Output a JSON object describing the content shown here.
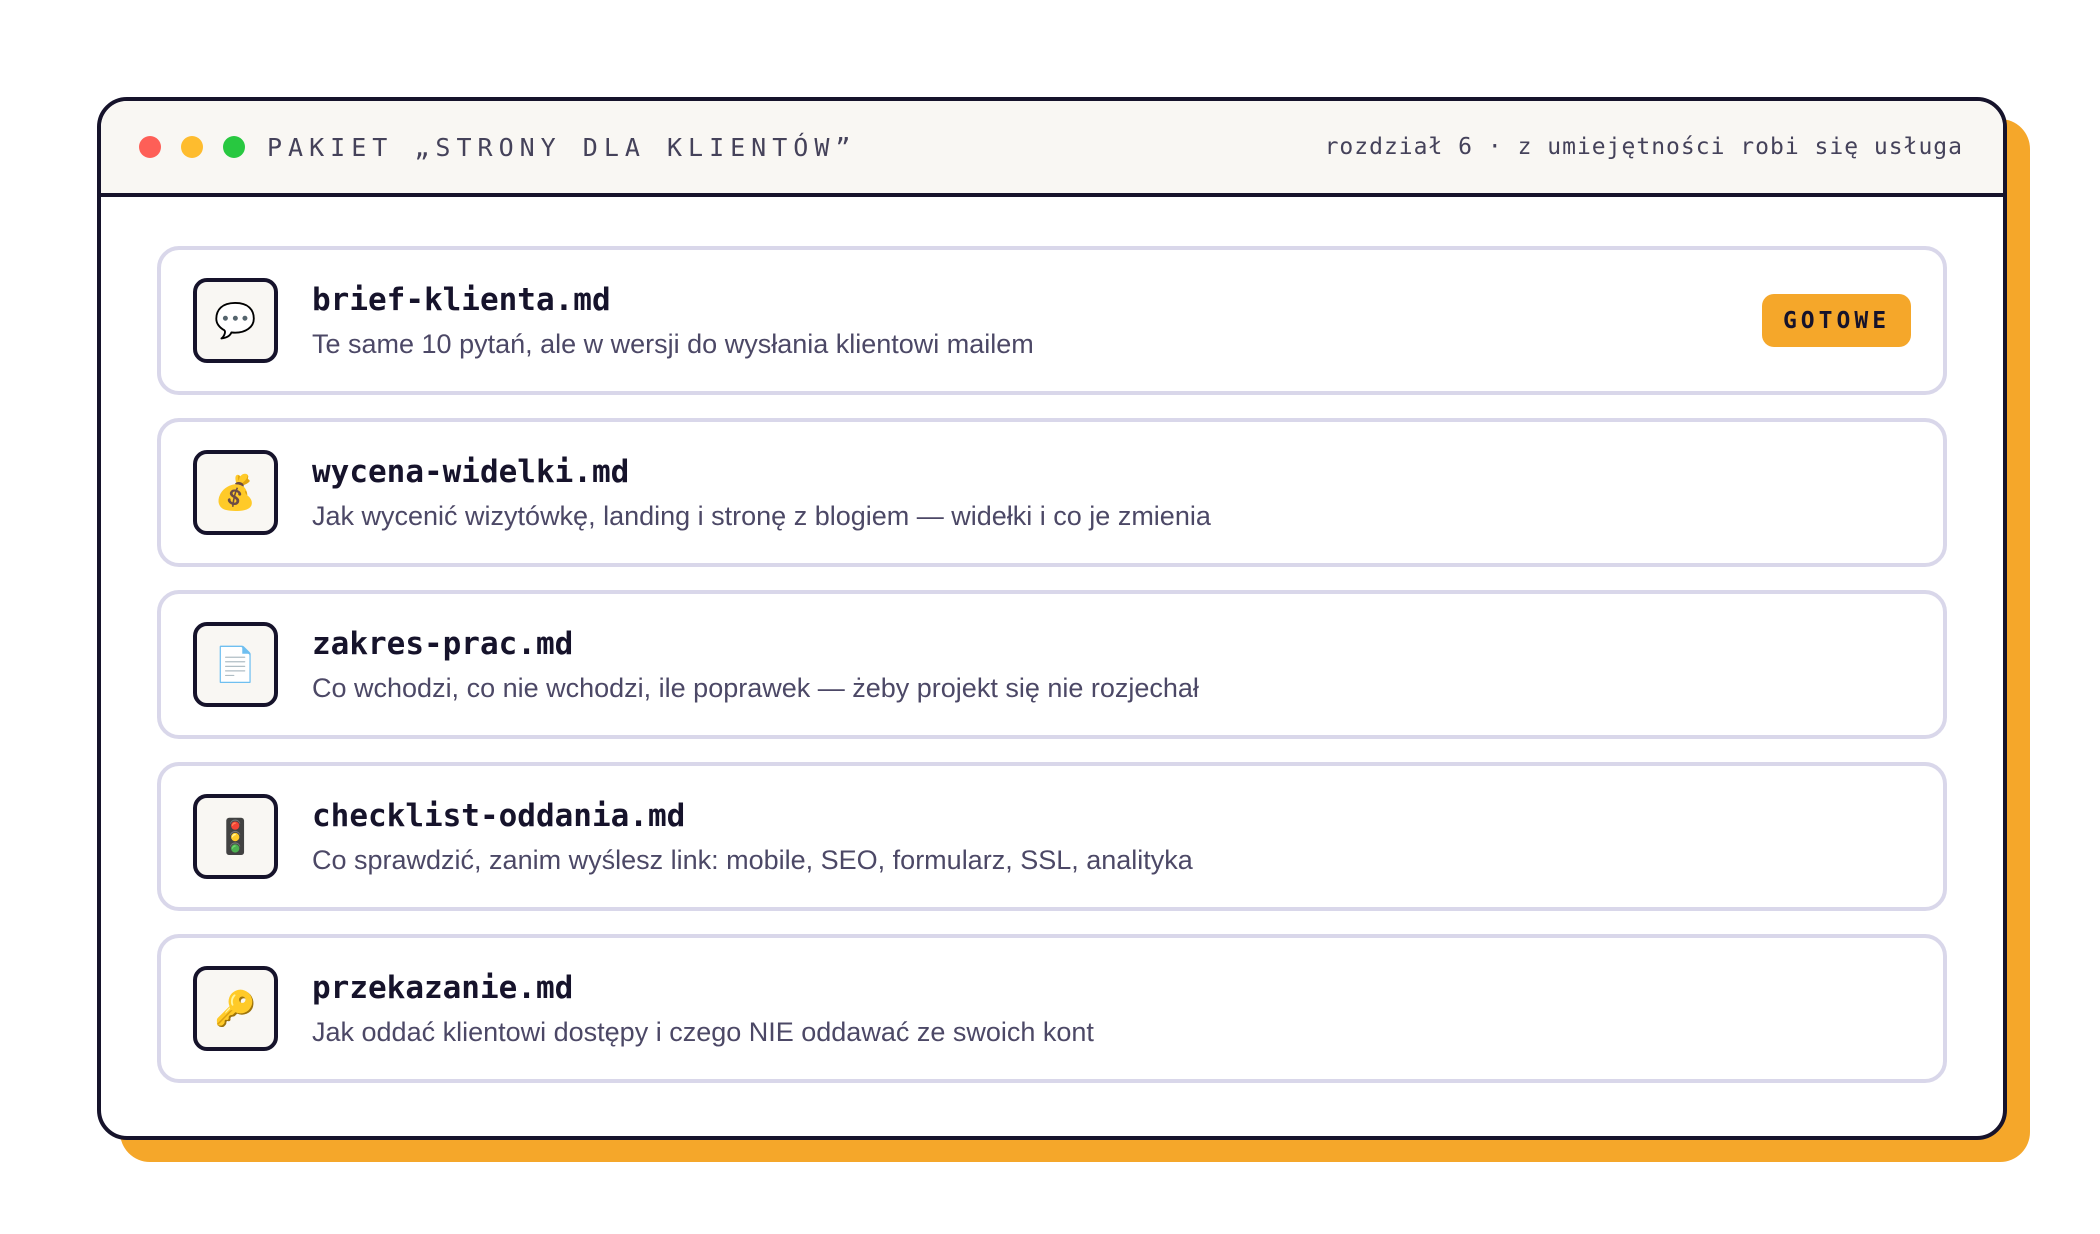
{
  "window": {
    "title": "PAKIET „STRONY DLA KLIENTÓW”",
    "subtitle": "rozdział 6 · z umiejętności robi się usługa"
  },
  "files": [
    {
      "name": "brief-klienta.md",
      "description": "Te same 10 pytań, ale w wersji do wysłania klientowi mailem",
      "icon": "💬",
      "icon_name": "speech-bubble-icon",
      "badge": "GOTOWE"
    },
    {
      "name": "wycena-widelki.md",
      "description": "Jak wycenić wizytówkę, landing i stronę z blogiem — widełki i co je zmienia",
      "icon": "💰",
      "icon_name": "money-bag-icon"
    },
    {
      "name": "zakres-prac.md",
      "description": "Co wchodzi, co nie wchodzi, ile poprawek — żeby projekt się nie rozjechał",
      "icon": "📄",
      "icon_name": "document-icon"
    },
    {
      "name": "checklist-oddania.md",
      "description": "Co sprawdzić, zanim wyślesz link: mobile, SEO, formularz, SSL, analityka",
      "icon": "🚦",
      "icon_name": "traffic-light-icon"
    },
    {
      "name": "przekazanie.md",
      "description": "Jak oddać klientowi dostępy i czego NIE oddawać ze swoich kont",
      "icon": "🔑",
      "icon_name": "key-icon"
    }
  ],
  "colors": {
    "accent": "#f5a72a",
    "border_dark": "#16132b",
    "card_border": "#d9d7ea",
    "titlebar_bg": "#f9f7f3"
  }
}
